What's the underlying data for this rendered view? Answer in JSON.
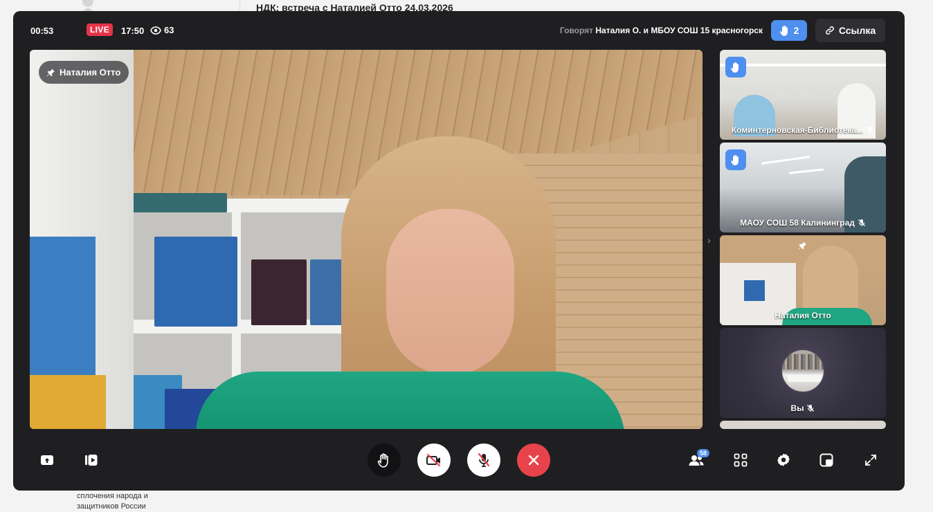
{
  "background_page": {
    "title": "НДК: встреча с Наталией Отто 24.03.2026",
    "sidebar_text_line1": "сплочения народа и",
    "sidebar_text_line2": "защитников России"
  },
  "topbar": {
    "elapsed": "00:53",
    "live_label": "LIVE",
    "clock": "17:50",
    "viewer_count": "63",
    "speaking_prefix": "Говорят",
    "speaking_names": "Наталия О. и МБОУ СОШ 15 красногорск",
    "raised_hands_count": "2",
    "link_label": "Ссылка"
  },
  "main_video": {
    "participant_name": "Наталия Отто"
  },
  "thumbnails": [
    {
      "name": "Коминтерновская-Библиотека...",
      "hand_raised": true,
      "muted": true
    },
    {
      "name": "МАОУ СОШ 58 Калининград",
      "hand_raised": true,
      "muted": true
    },
    {
      "name": "Наталия Отто",
      "hand_raised": false,
      "muted": false,
      "pinned": true
    },
    {
      "name": "Вы",
      "hand_raised": false,
      "muted": true
    }
  ],
  "controls": {
    "participants_count": "58"
  },
  "colors": {
    "modal_bg": "#1f1f21",
    "accent_blue": "#4e8ff0",
    "live_red": "#e8334a",
    "end_call_red": "#e8434b"
  }
}
